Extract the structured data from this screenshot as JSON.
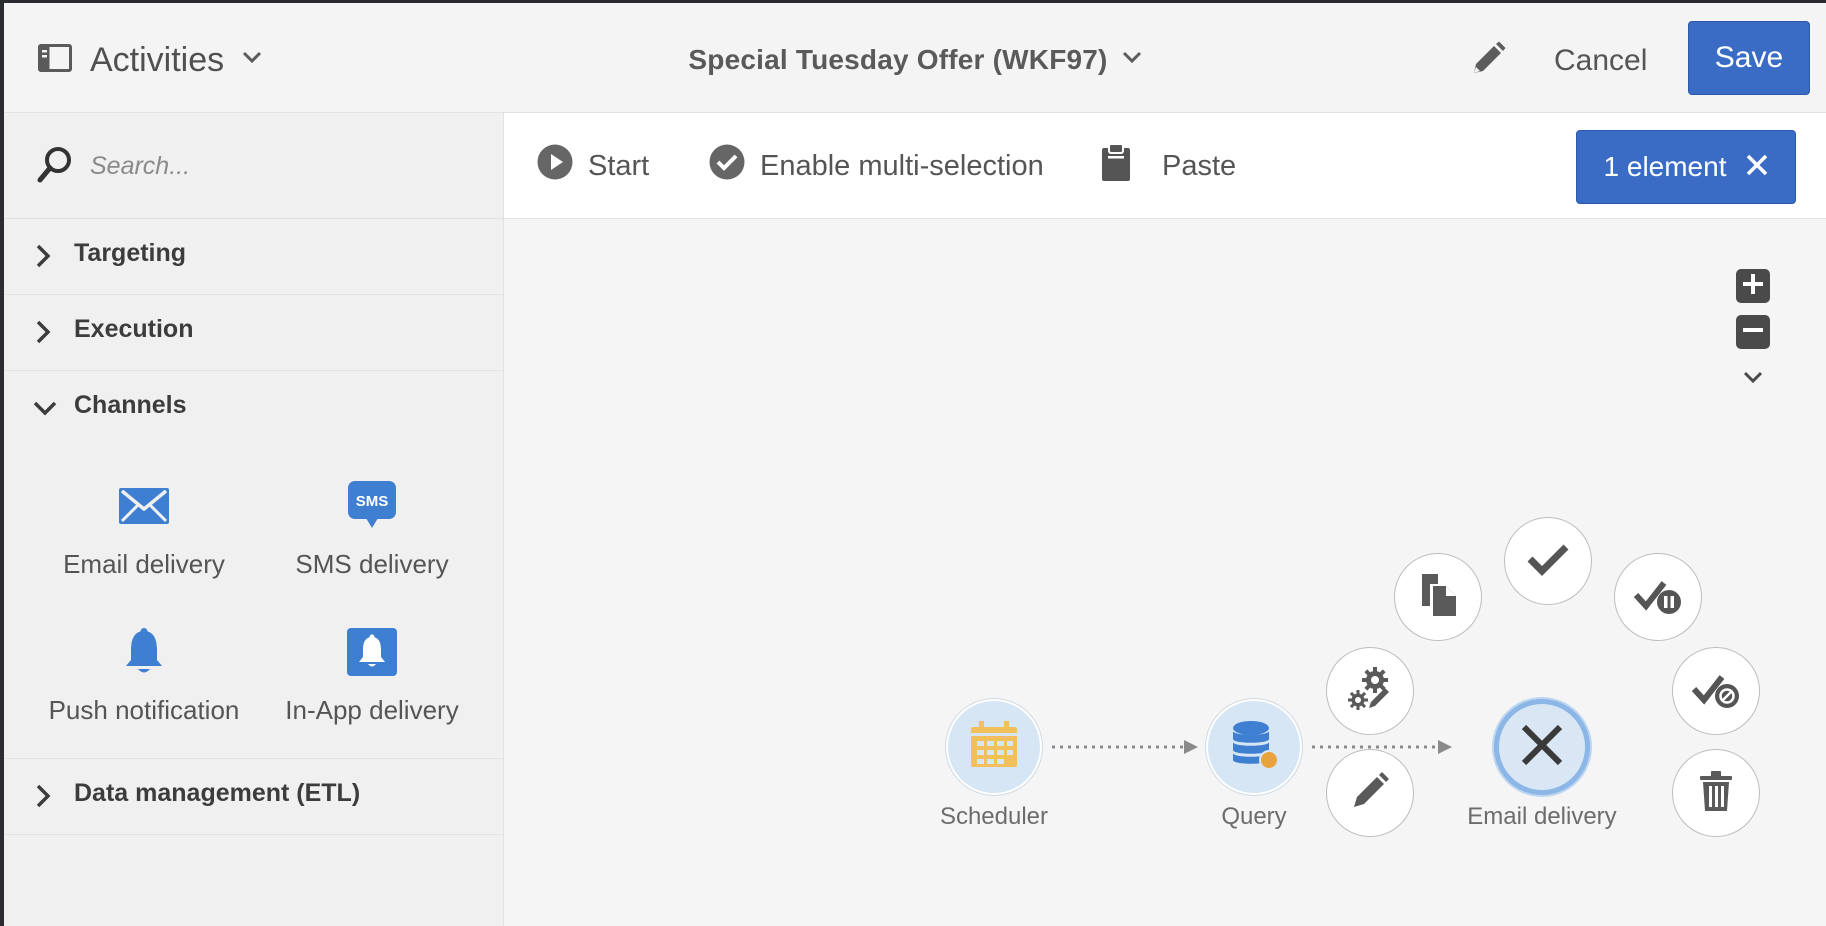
{
  "header": {
    "activities_label": "Activities",
    "workflow_title": "Special Tuesday Offer (WKF97)",
    "cancel_label": "Cancel",
    "save_label": "Save"
  },
  "sidebar": {
    "search_placeholder": "Search...",
    "categories": [
      {
        "label": "Targeting",
        "expanded": false
      },
      {
        "label": "Execution",
        "expanded": false
      },
      {
        "label": "Channels",
        "expanded": true
      },
      {
        "label": "Data management (ETL)",
        "expanded": false
      }
    ],
    "channels": [
      {
        "label": "Email delivery",
        "icon": "envelope-icon"
      },
      {
        "label": "SMS delivery",
        "icon": "sms-icon",
        "icon_text": "SMS"
      },
      {
        "label": "Push notification",
        "icon": "bell-icon"
      },
      {
        "label": "In-App delivery",
        "icon": "in-app-bell-icon"
      }
    ]
  },
  "toolbar": {
    "start_label": "Start",
    "multiselect_label": "Enable multi-selection",
    "paste_label": "Paste",
    "selection_badge": "1 element"
  },
  "canvas": {
    "nodes": [
      {
        "label": "Scheduler",
        "icon": "calendar-icon"
      },
      {
        "label": "Query",
        "icon": "database-icon"
      },
      {
        "label": "Email delivery",
        "icon": "close-icon",
        "selected": true
      }
    ],
    "radial_menu": [
      "copy-icon",
      "confirm-icon",
      "pause-icon",
      "settings-icon",
      "disable-icon",
      "edit-icon",
      "delete-icon"
    ]
  },
  "colors": {
    "accent": "#3a6cc6",
    "icon_blue": "#3e7fd1",
    "node_fill": "#d6e6f4",
    "calendar": "#f2c05a",
    "query_dot": "#e8a33c"
  }
}
